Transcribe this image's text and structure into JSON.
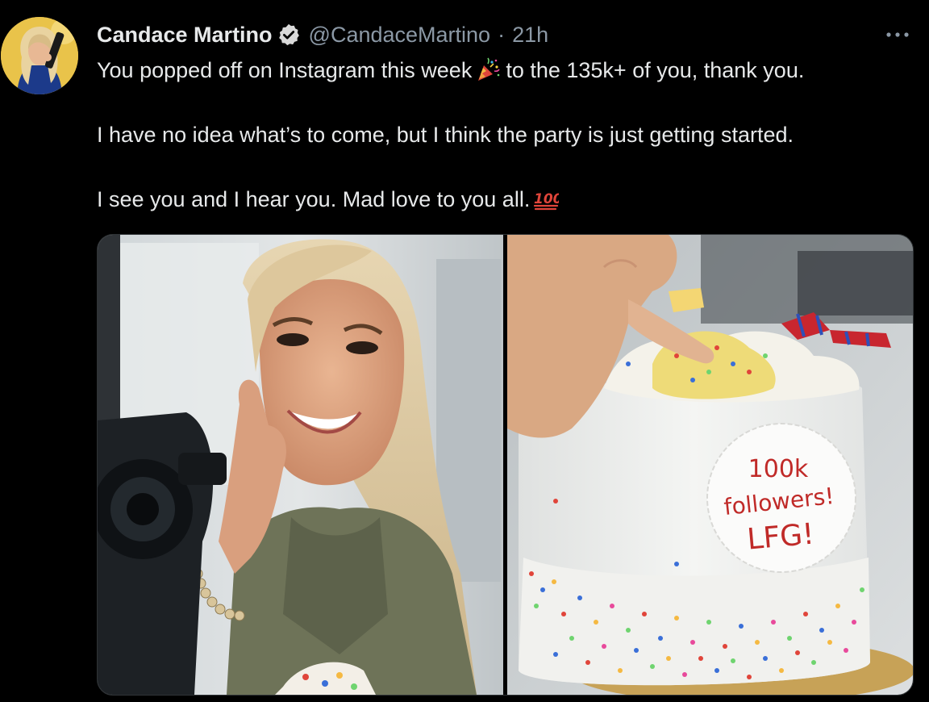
{
  "tweet": {
    "display_name": "Candace Martino",
    "handle": "@CandaceMartino",
    "separator": "·",
    "time": "21h",
    "lines": [
      {
        "before": "You popped off on Instagram this week",
        "emoji": "party-popper",
        "after": "to the 135k+ of you, thank you."
      },
      {
        "text": "I have no idea what’s to come, but I think the party is just getting started."
      },
      {
        "before": "I see you and I hear you. Mad love to you all.",
        "emoji": "hundred-points"
      }
    ],
    "cake_topper": {
      "line1": "100k",
      "line2": "followers!",
      "line3": "LFG!"
    }
  },
  "icons": {
    "verified": "verified-badge-icon",
    "more": "more-icon"
  },
  "colors": {
    "background": "#000000",
    "text_primary": "#e7e9ea",
    "text_secondary": "#8b98a5",
    "verified_badge": "#d9d9d9"
  }
}
